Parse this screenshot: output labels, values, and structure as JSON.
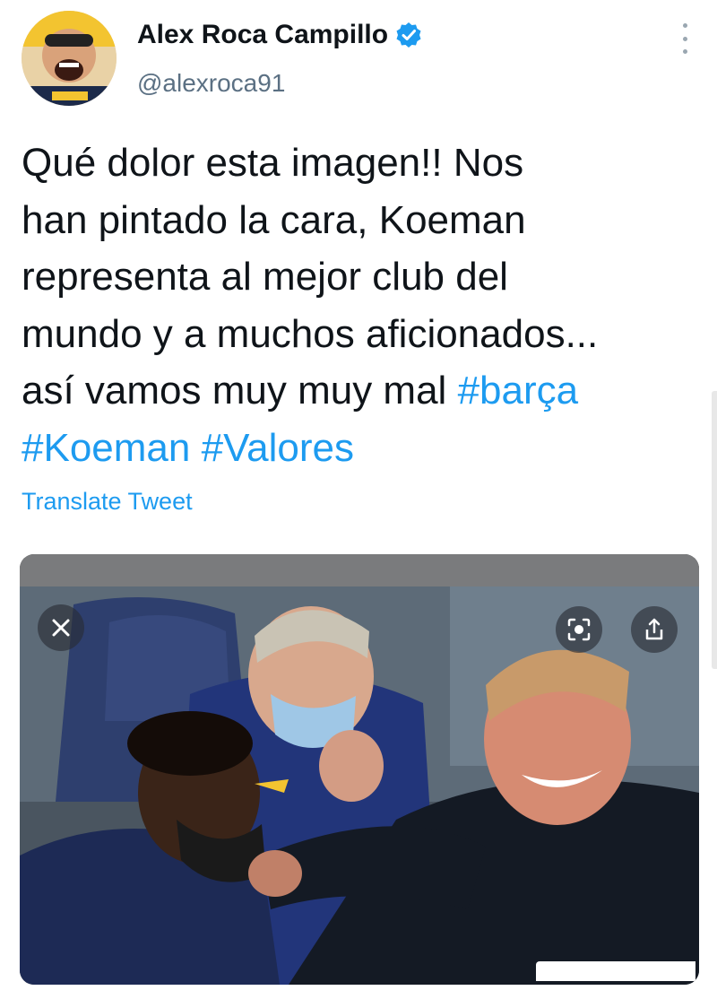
{
  "user": {
    "display_name": "Alex Roca Campillo",
    "handle": "@alexroca91",
    "verified": true
  },
  "tweet": {
    "text": "Qué dolor esta imagen!! Nos\nhan pintado la cara, Koeman\nrepresenta al mejor club del\nmundo y a muchos aficionados...\nasí vamos muy muy mal ",
    "hashtags": [
      "#barça",
      "#Koeman",
      "#Valores"
    ],
    "translate_label": "Translate Tweet"
  },
  "media": {
    "close_icon": "close-icon",
    "lens_icon": "lens-search-icon",
    "share_icon": "share-icon"
  },
  "colors": {
    "accent": "#1d9bf0",
    "text": "#0f1419",
    "secondary": "#5b7083"
  }
}
